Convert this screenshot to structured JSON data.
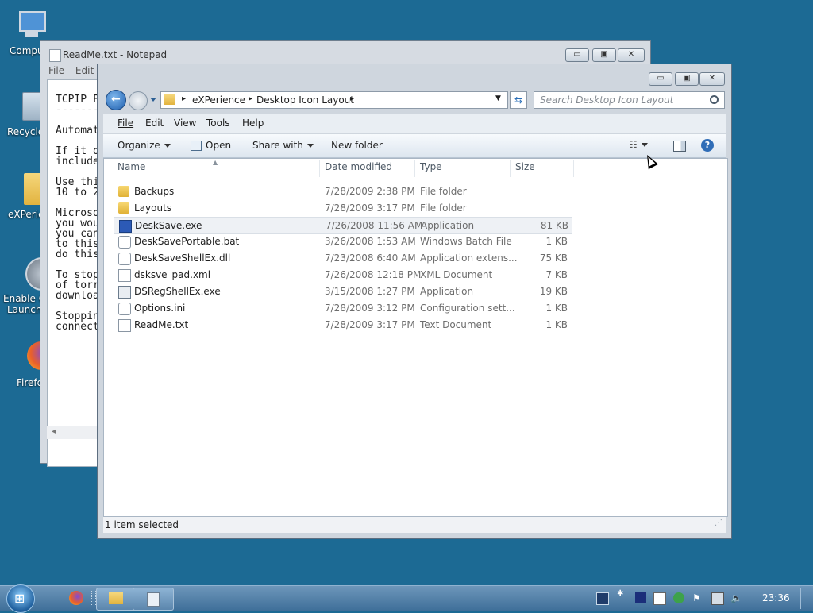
{
  "desktop": {
    "icons": [
      {
        "label": "Compu"
      },
      {
        "label": "Recycle"
      },
      {
        "label": "eXPerie"
      },
      {
        "label": "Enable Q"
      },
      {
        "label": "Launch."
      },
      {
        "label": "Firefo"
      }
    ]
  },
  "notepad": {
    "title": "ReadMe.txt - Notepad",
    "menu": [
      "File",
      "Edit"
    ],
    "lines": [
      "TCPIP F",
      "-------",
      "",
      "Automat",
      "",
      "If it o",
      "include",
      "",
      "Use thi",
      "10 to 2",
      "",
      "Microso",
      "you wou",
      "you can",
      "to this",
      "do this",
      "",
      "To stop",
      "of torr",
      "downloa",
      "",
      "Stoppin",
      "connect"
    ],
    "scroll_left": "◂"
  },
  "explorer": {
    "breadcrumb": [
      "eXPerience",
      "Desktop Icon Layout"
    ],
    "search_placeholder": "Search Desktop Icon Layout",
    "menu": [
      "File",
      "Edit",
      "View",
      "Tools",
      "Help"
    ],
    "commands": {
      "organize": "Organize",
      "open": "Open",
      "share": "Share with",
      "new_folder": "New folder"
    },
    "columns": {
      "name": "Name",
      "date": "Date modified",
      "type": "Type",
      "size": "Size"
    },
    "files": [
      {
        "name": "Backups",
        "date": "7/28/2009 2:38 PM",
        "type": "File folder",
        "size": "",
        "icon": "folder"
      },
      {
        "name": "Layouts",
        "date": "7/28/2009 3:17 PM",
        "type": "File folder",
        "size": "",
        "icon": "folder"
      },
      {
        "name": "DeskSave.exe",
        "date": "7/26/2008 11:56 AM",
        "type": "Application",
        "size": "81 KB",
        "icon": "app",
        "selected": true
      },
      {
        "name": "DeskSavePortable.bat",
        "date": "3/26/2008 1:53 AM",
        "type": "Windows Batch File",
        "size": "1 KB",
        "icon": "gear"
      },
      {
        "name": "DeskSaveShellEx.dll",
        "date": "7/23/2008 6:40 AM",
        "type": "Application extens...",
        "size": "75 KB",
        "icon": "gear"
      },
      {
        "name": "dsksve_pad.xml",
        "date": "7/26/2008 12:18 PM",
        "type": "XML Document",
        "size": "7 KB",
        "icon": "doc"
      },
      {
        "name": "DSRegShellEx.exe",
        "date": "3/15/2008 1:27 PM",
        "type": "Application",
        "size": "19 KB",
        "icon": "app"
      },
      {
        "name": "Options.ini",
        "date": "7/28/2009 3:12 PM",
        "type": "Configuration sett...",
        "size": "1 KB",
        "icon": "gear"
      },
      {
        "name": "ReadMe.txt",
        "date": "7/28/2009 3:17 PM",
        "type": "Text Document",
        "size": "1 KB",
        "icon": "doc"
      }
    ],
    "status": "1 item selected"
  },
  "taskbar": {
    "clock": "23:36"
  },
  "colors": {
    "desktop": "#1c6a94",
    "selection": "#eef1f5",
    "accent": "#2a6fb8"
  }
}
